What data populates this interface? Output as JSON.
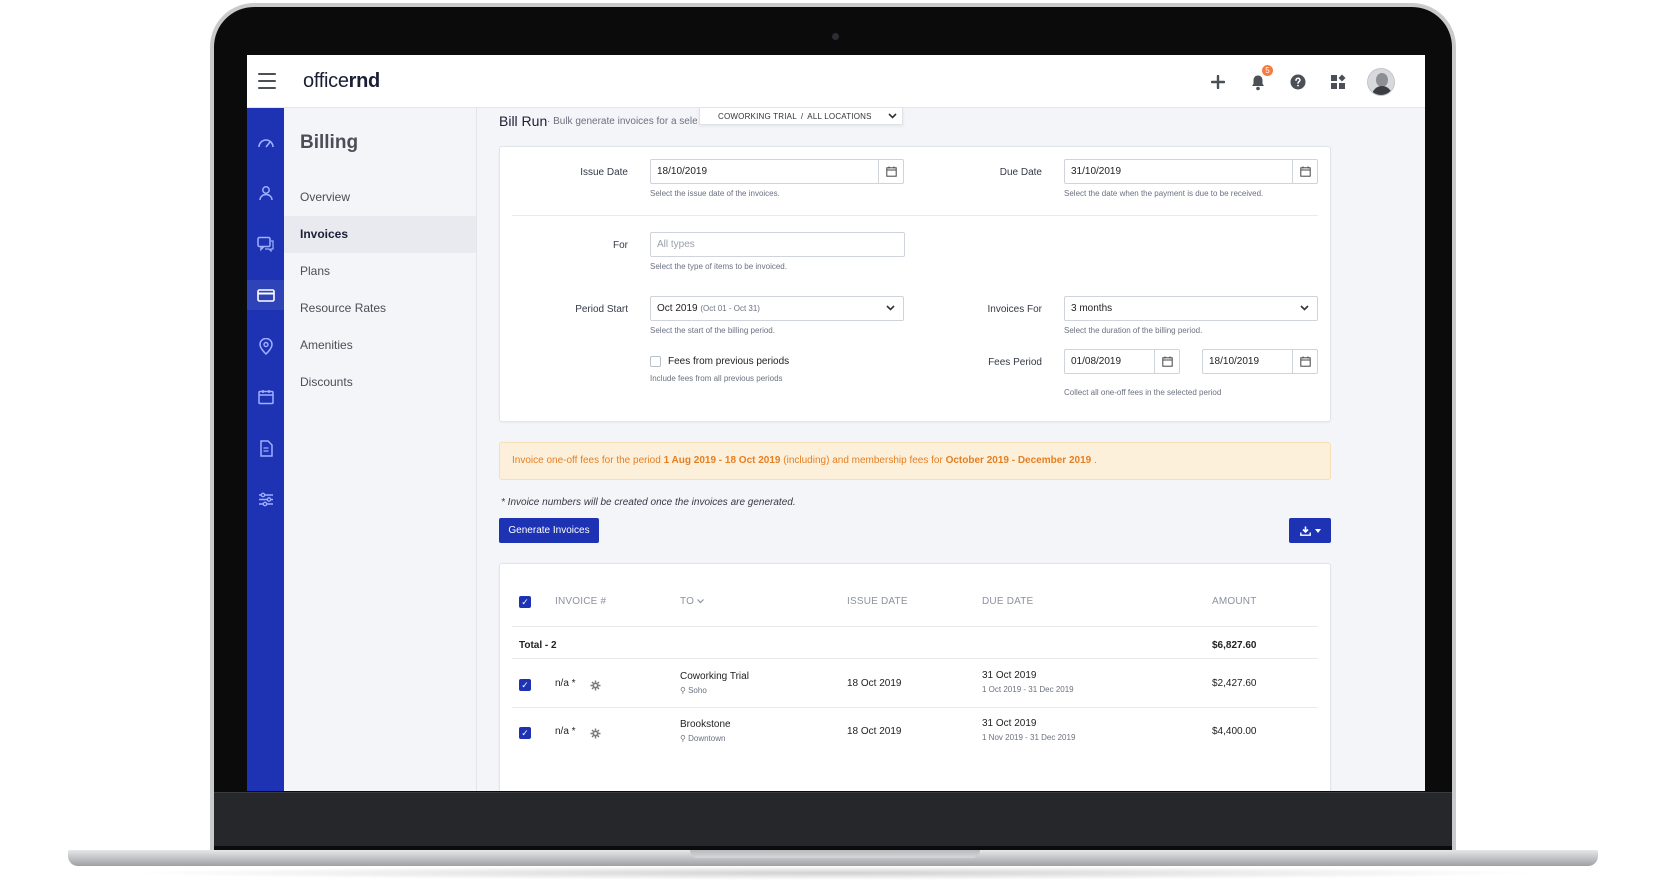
{
  "app": {
    "brand_prefix": "office",
    "brand_suffix": "rnd",
    "notification_count": "5"
  },
  "sidebar": {
    "title": "Billing",
    "items": [
      {
        "label": "Overview"
      },
      {
        "label": "Invoices"
      },
      {
        "label": "Plans"
      },
      {
        "label": "Resource Rates"
      },
      {
        "label": "Amenities"
      },
      {
        "label": "Discounts"
      }
    ]
  },
  "page": {
    "title": "Bill Run",
    "subtitle": "· Bulk generate invoices for a selec",
    "location_selector": {
      "company": "COWORKING TRIAL",
      "separator": "/",
      "location": "ALL LOCATIONS"
    }
  },
  "form": {
    "issue_date": {
      "label": "Issue Date",
      "value": "18/10/2019",
      "help": "Select the issue date of the invoices."
    },
    "due_date": {
      "label": "Due Date",
      "value": "31/10/2019",
      "help": "Select the date when the payment is due to be received."
    },
    "for": {
      "label": "For",
      "placeholder": "All types",
      "help": "Select the type of items to be invoiced."
    },
    "period_start": {
      "label": "Period Start",
      "value": "Oct 2019",
      "range": "(Oct 01 - Oct 31)",
      "help": "Select the start of the billing period."
    },
    "invoices_for": {
      "label": "Invoices For",
      "value": "3 months",
      "help": "Select the duration of the billing period."
    },
    "fees_previous": {
      "label": "Fees from previous periods",
      "help": "Include fees from all previous periods"
    },
    "fees_period": {
      "label": "Fees Period",
      "from": "01/08/2019",
      "to": "18/10/2019",
      "help": "Collect all one-off fees in the selected period"
    }
  },
  "alert": {
    "part1": "Invoice one-off fees for the period ",
    "period": "1 Aug 2019 - 18 Oct 2019",
    "part2": " (including) and membership fees for ",
    "membership": "October 2019 - December 2019",
    "part3": " ."
  },
  "note": "* Invoice numbers will be created once the invoices are generated.",
  "buttons": {
    "generate": "Generate Invoices"
  },
  "table": {
    "headers": {
      "invoice": "INVOICE #",
      "to": "TO",
      "issue_date": "ISSUE DATE",
      "due_date": "DUE DATE",
      "amount": "AMOUNT"
    },
    "total": {
      "label": "Total - 2",
      "amount": "$6,827.60"
    },
    "rows": [
      {
        "invoice": "n/a *",
        "to": "Coworking Trial",
        "location": "Soho",
        "issue_date": "18 Oct 2019",
        "due_date": "31 Oct 2019",
        "period": "1 Oct 2019 - 31 Dec 2019",
        "amount": "$2,427.60"
      },
      {
        "invoice": "n/a *",
        "to": "Brookstone",
        "location": "Downtown",
        "issue_date": "18 Oct 2019",
        "due_date": "31 Oct 2019",
        "period": "1 Nov 2019 - 31 Dec 2019",
        "amount": "$4,400.00"
      }
    ]
  },
  "colors": {
    "primary": "#1e33b4",
    "alert_bg": "#fdf0da",
    "alert_text": "#e67e22"
  }
}
